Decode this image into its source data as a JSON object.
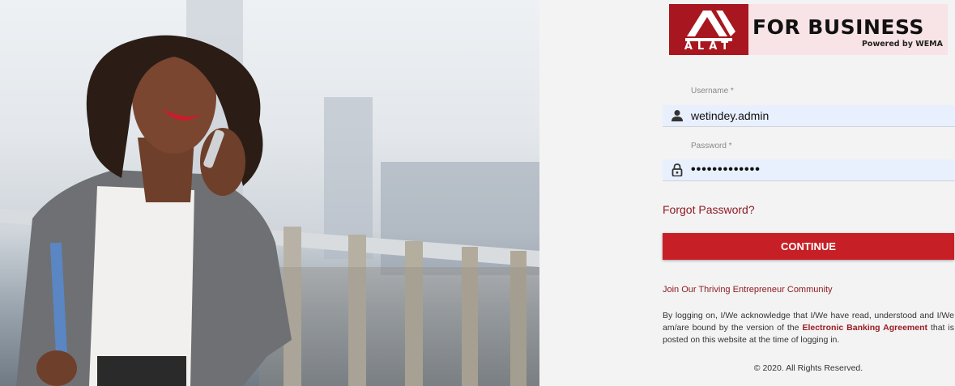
{
  "brand": {
    "mark_text": "ALAT",
    "name": "FOR BUSINESS",
    "powered_by": "Powered by WEMA",
    "colors": {
      "primary": "#c62026",
      "logo_bg": "#a8171f",
      "logo_panel": "#f8e3e6",
      "link": "#8e1b23"
    }
  },
  "hero": {
    "description_icon": "woman-on-phone-photo"
  },
  "login": {
    "username_label": "Username *",
    "username_value": "wetindey.admin",
    "username_icon": "person-icon",
    "password_label": "Password *",
    "password_value": "•••••••••••••",
    "password_icon": "lock-icon",
    "forgot_label": "Forgot Password?",
    "continue_label": "CONTINUE"
  },
  "footer": {
    "join_label": "Join Our Thriving Entrepreneur Community",
    "legal_pre": "By logging on, I/We acknowledge that I/We have read, understood and I/We am/are bound by the version of the ",
    "legal_link": "Electronic Banking Agreement",
    "legal_post": " that is posted on this website at the time of logging in.",
    "copyright": "© 2020. All Rights Reserved."
  }
}
